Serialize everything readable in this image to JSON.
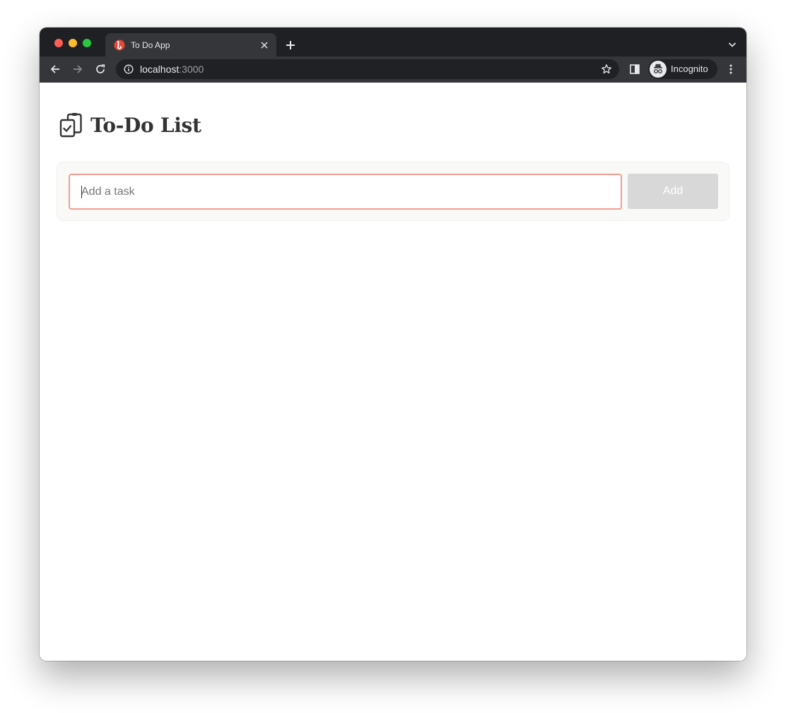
{
  "browser": {
    "tab": {
      "title": "To Do App",
      "favicon": "to-do-app-favicon"
    },
    "address": {
      "host": "localhost",
      "port": ":3000"
    },
    "profile_label": "Incognito",
    "icons": {
      "back": "arrow-left-icon",
      "forward": "arrow-right-icon",
      "reload": "reload-icon",
      "info": "info-icon",
      "bookmark": "star-icon",
      "side_panel": "side-panel-icon",
      "menu": "kebab-menu-icon",
      "new_tab": "plus-icon",
      "tab_search": "chevron-down-icon"
    }
  },
  "page": {
    "title": "To-Do List",
    "title_icon": "clipboard-check-icon",
    "task_input": {
      "placeholder": "Add a task",
      "value": ""
    },
    "add_button_label": "Add"
  },
  "colors": {
    "favicon": "#e4493b",
    "input_border": "#f29d93",
    "add_button_disabled": "#d8d8d8",
    "tabstrip": "#1f2023",
    "toolbar": "#35363a"
  }
}
